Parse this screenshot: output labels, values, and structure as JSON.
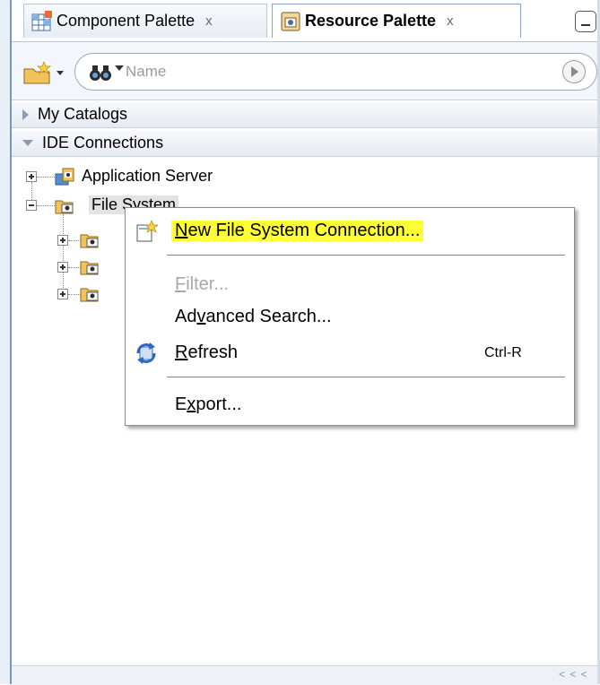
{
  "tabs": [
    {
      "label": "Component Palette",
      "close": "x",
      "active": false
    },
    {
      "label": "Resource Palette",
      "close": "x",
      "active": true
    }
  ],
  "search": {
    "placeholder": "Name"
  },
  "sections": {
    "my_catalogs": "My Catalogs",
    "ide_connections": "IDE Connections"
  },
  "tree": {
    "application_server": "Application Server",
    "file_system": "File System"
  },
  "context_menu": {
    "new_connection": {
      "pre": "",
      "mnemonic": "N",
      "post": "ew File System Connection..."
    },
    "filter": {
      "pre": "",
      "mnemonic": "F",
      "post": "ilter..."
    },
    "advanced_search": {
      "pre": "Ad",
      "mnemonic": "v",
      "post": "anced Search..."
    },
    "refresh": {
      "pre": "",
      "mnemonic": "R",
      "post": "efresh",
      "accel": "Ctrl-R"
    },
    "export": {
      "pre": "E",
      "mnemonic": "x",
      "post": "port..."
    }
  },
  "status": {
    "scroll_indicator": "< < <"
  },
  "colors": {
    "highlight": "#ffff33",
    "accent": "#7c95b8"
  },
  "icons": [
    "component-palette-icon",
    "resource-palette-icon",
    "new-item-icon",
    "binoculars-icon",
    "go-icon",
    "server-connection-icon",
    "folder-connection-icon",
    "refresh-icon"
  ]
}
